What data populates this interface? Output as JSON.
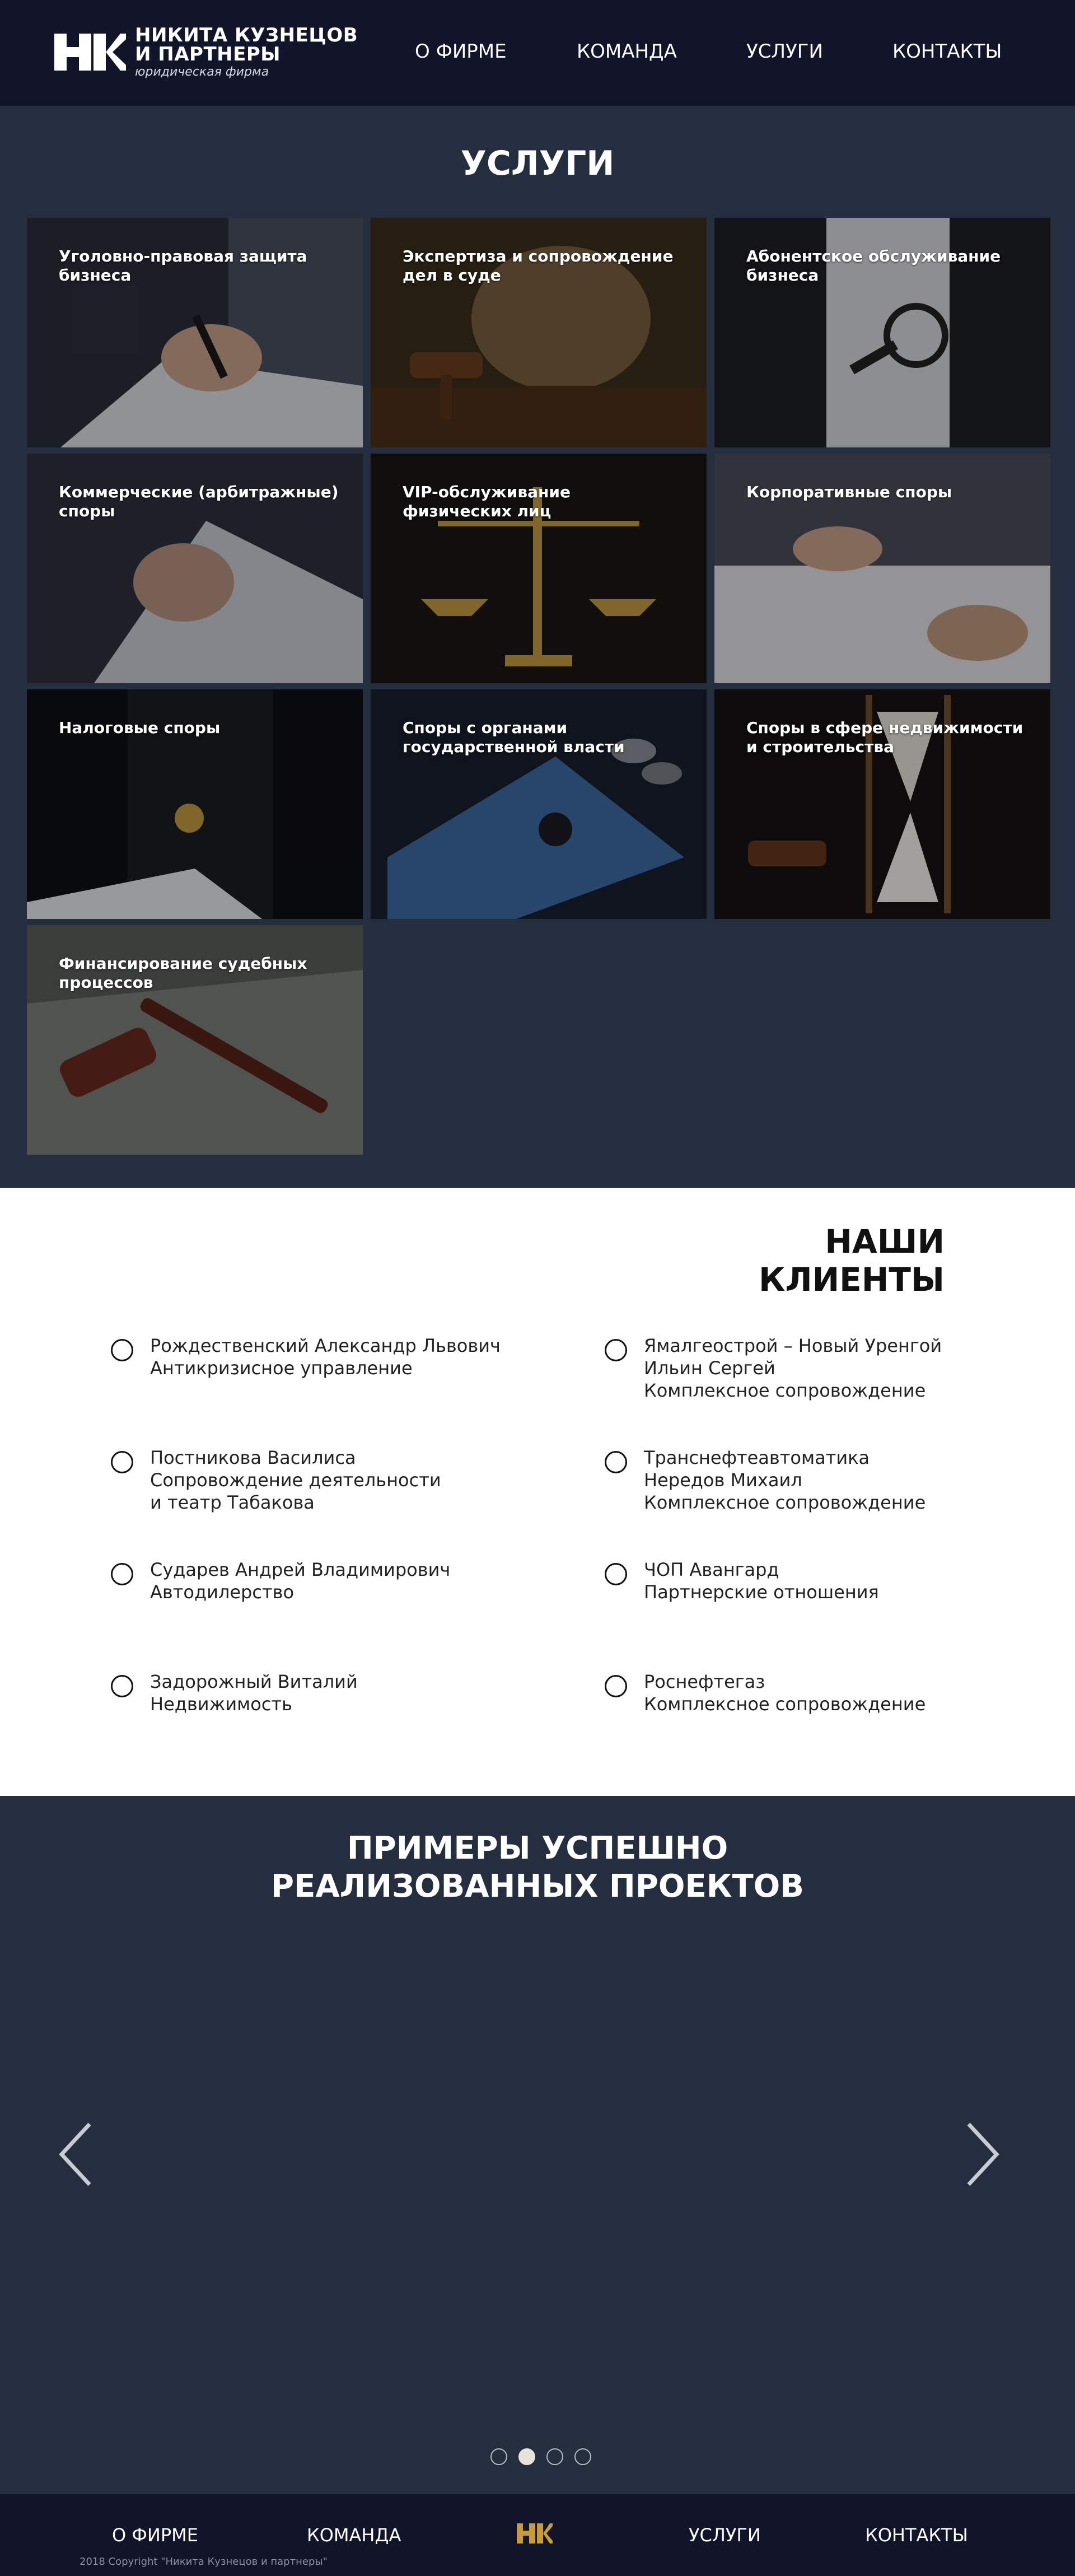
{
  "header": {
    "logo": {
      "initials": "НК",
      "line1": "НИКИТА КУЗНЕЦОВ",
      "line2": "И ПАРТНЕРЫ",
      "tagline": "юридическая фирма"
    },
    "nav": [
      "О ФИРМЕ",
      "КОМАНДА",
      "УСЛУГИ",
      "КОНТАКТЫ"
    ]
  },
  "services": {
    "title": "УСЛУГИ",
    "cards": [
      {
        "title": "Уголовно-правовая защита бизнеса",
        "image": "signing-document-photo"
      },
      {
        "title": "Экспертиза и сопровождение дел в суде",
        "image": "judge-gavel-photo"
      },
      {
        "title": "Абонентское обслуживание бизнеса",
        "image": "magnifier-photo"
      },
      {
        "title": "Коммерческие (арбитражные) споры",
        "image": "book-pages-photo"
      },
      {
        "title": "VIP-обслуживание физических лиц",
        "image": "scales-of-justice-photo"
      },
      {
        "title": "Корпоративные споры",
        "image": "handshake-photo"
      },
      {
        "title": "Налоговые споры",
        "image": "judge-robe-photo"
      },
      {
        "title": "Споры с органами государственной власти",
        "image": "coins-shadow-photo"
      },
      {
        "title": "Споры в сфере недвижимости и строительства",
        "image": "hourglass-photo"
      },
      {
        "title": "Финансирование судебных процессов",
        "image": "gavel-money-photo"
      }
    ]
  },
  "clients": {
    "title_line1": "НАШИ",
    "title_line2": "КЛИЕНТЫ",
    "items": [
      {
        "lines": [
          "Рождественский Александр Львович",
          "Антикризисное управление"
        ]
      },
      {
        "lines": [
          "Ямалгеострой – Новый Уренгой",
          "Ильин Сергей",
          "Комплексное сопровождение"
        ]
      },
      {
        "lines": [
          "Постникова Василиса",
          "Сопровождение деятельности",
          "и театр Табакова"
        ]
      },
      {
        "lines": [
          "Транснефтеавтоматика",
          "Нередов Михаил",
          "Комплексное сопровождение"
        ]
      },
      {
        "lines": [
          "Сударев Андрей Владимирович",
          "Автодилерство"
        ]
      },
      {
        "lines": [
          "ЧОП Авангард",
          "Партнерские отношения"
        ]
      },
      {
        "lines": [
          "Задорожный Виталий",
          "Недвижимость"
        ]
      },
      {
        "lines": [
          "Роснефтегаз",
          "Комплексное сопровождение"
        ]
      }
    ]
  },
  "projects": {
    "title_line1": "ПРИМЕРЫ УСПЕШНО",
    "title_line2": "РЕАЛИЗОВАННЫХ ПРОЕКТОВ",
    "slides_total": 4,
    "active_slide": 2
  },
  "footer": {
    "nav": [
      "О ФИРМЕ",
      "КОМАНДА",
      "УСЛУГИ",
      "КОНТАКТЫ"
    ],
    "logo": "НК",
    "copyright": "2018 Copyright \"Никита Кузнецов и партнеры\""
  },
  "colors": {
    "header_bg": "#12152a",
    "section_bg": "#252e3e",
    "clients_bg": "#ffffff",
    "logo_accent": "#c79a3a"
  }
}
